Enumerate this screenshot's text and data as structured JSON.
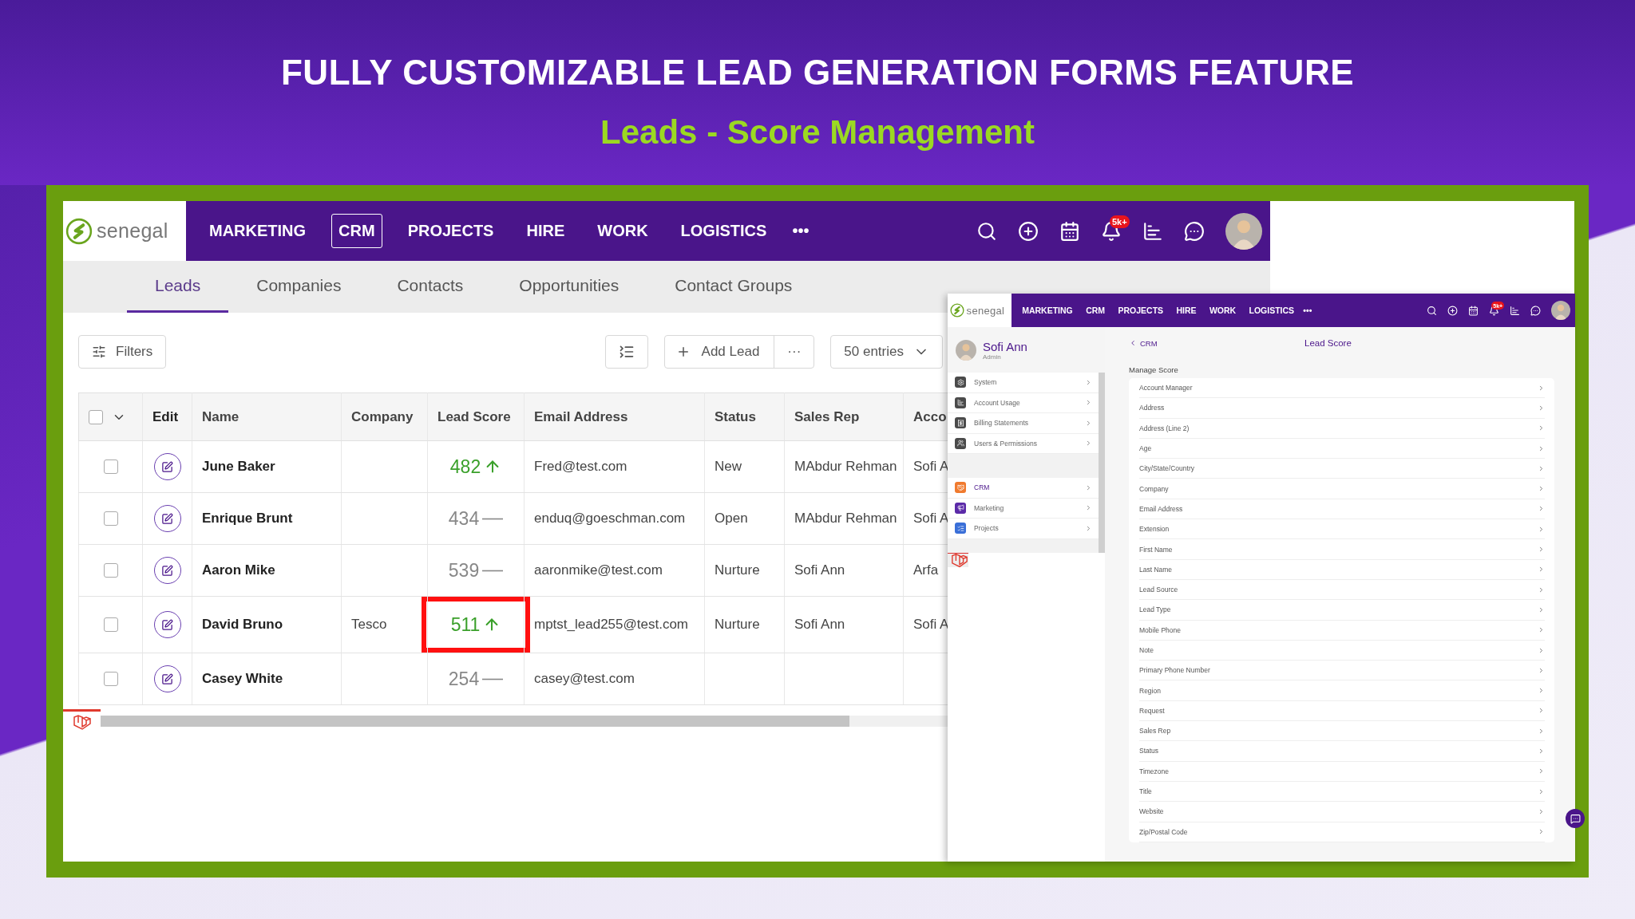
{
  "banner": {
    "title": "FULLY CUSTOMIZABLE LEAD GENERATION FORMS FEATURE",
    "subtitle": "Leads - Score Management"
  },
  "main_app": {
    "logo": "senegal",
    "nav": [
      {
        "label": "MARKETING",
        "selected": false
      },
      {
        "label": "CRM",
        "selected": true
      },
      {
        "label": "PROJECTS",
        "selected": false
      },
      {
        "label": "HIRE",
        "selected": false
      },
      {
        "label": "WORK",
        "selected": false
      },
      {
        "label": "LOGISTICS",
        "selected": false
      }
    ],
    "more": "•••",
    "badge": "5k+",
    "subtabs": [
      {
        "label": "Leads",
        "selected": true
      },
      {
        "label": "Companies",
        "selected": false
      },
      {
        "label": "Contacts",
        "selected": false
      },
      {
        "label": "Opportunities",
        "selected": false
      },
      {
        "label": "Contact Groups",
        "selected": false
      }
    ],
    "toolbar": {
      "filters": "Filters",
      "add_lead": "Add Lead",
      "more": "···",
      "entries": "50 entries"
    },
    "table": {
      "select_all_checked": false,
      "columns": [
        "Edit",
        "Name",
        "Company",
        "Lead Score",
        "Email Address",
        "Status",
        "Sales Rep",
        "Acco"
      ],
      "rows": [
        {
          "checked": false,
          "name": "June Baker",
          "company": "",
          "score": "482",
          "kind": "up",
          "highlighted": false,
          "email": "Fred@test.com",
          "status": "New",
          "sales_rep": "MAbdur Rehman",
          "column_9": "Sofi A"
        },
        {
          "checked": false,
          "name": "Enrique Brunt",
          "company": "",
          "score": "434",
          "kind": "flat",
          "highlighted": false,
          "email": "enduq@goeschman.com",
          "status": "Open",
          "sales_rep": "MAbdur Rehman",
          "column_9": "Sofi A"
        },
        {
          "checked": false,
          "name": "Aaron Mike",
          "company": "",
          "score": "539",
          "kind": "flat",
          "highlighted": false,
          "email": "aaronmike@test.com",
          "status": "Nurture",
          "sales_rep": "Sofi Ann",
          "column_9": "Arfa"
        },
        {
          "checked": false,
          "name": "David Bruno",
          "company": "Tesco",
          "score": "511",
          "kind": "up",
          "highlighted": true,
          "email": "mptst_lead255@test.com",
          "status": "Nurture",
          "sales_rep": "Sofi Ann",
          "column_9": "Sofi A"
        },
        {
          "checked": false,
          "name": "Casey White",
          "company": "",
          "score": "254",
          "kind": "flat",
          "highlighted": false,
          "email": "casey@test.com",
          "status": "",
          "sales_rep": "",
          "column_9": ""
        }
      ]
    }
  },
  "inset_app": {
    "logo": "senegal",
    "nav": [
      {
        "label": "MARKETING",
        "selected": false
      },
      {
        "label": "CRM",
        "selected": false
      },
      {
        "label": "PROJECTS",
        "selected": false
      },
      {
        "label": "HIRE",
        "selected": false
      },
      {
        "label": "WORK",
        "selected": false
      },
      {
        "label": "LOGISTICS",
        "selected": false
      }
    ],
    "more": "•••",
    "badge": "5k+",
    "user": {
      "name": "Sofi Ann",
      "role": "Admin"
    },
    "sidebar": [
      {
        "label": "System",
        "color": "#4a4a4a",
        "selected": false
      },
      {
        "label": "Account Usage",
        "color": "#4a4a4a",
        "selected": false
      },
      {
        "label": "Billing Statements",
        "color": "#4a4a4a",
        "selected": false
      },
      {
        "label": "Users & Permissions",
        "color": "#4a4a4a",
        "selected": false
      },
      {
        "label": "CRM",
        "color": "#f07a2e",
        "selected": true
      },
      {
        "label": "Marketing",
        "color": "#5b2aa8",
        "selected": false
      },
      {
        "label": "Projects",
        "color": "#3a6fd8",
        "selected": false
      }
    ],
    "back": "CRM",
    "title": "Lead Score",
    "section": "Manage Score",
    "fields": [
      "Account Manager",
      "Address",
      "Address (Line 2)",
      "Age",
      "City/State/Country",
      "Company",
      "Email Address",
      "Extension",
      "First Name",
      "Last Name",
      "Lead Source",
      "Lead Type",
      "Mobile Phone",
      "Note",
      "Primary Phone Number",
      "Region",
      "Request",
      "Sales Rep",
      "Status",
      "Timezone",
      "Title",
      "Website",
      "Zip/Postal Code"
    ]
  }
}
